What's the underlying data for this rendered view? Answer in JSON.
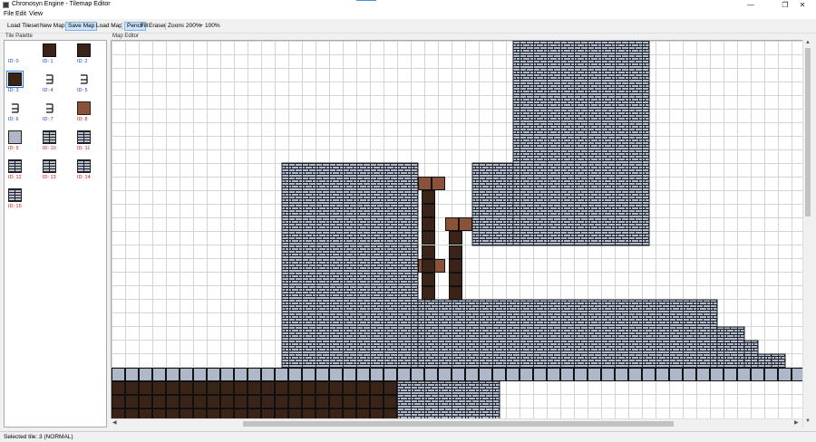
{
  "window": {
    "title": "Chronosyn Engine - Tilemap Editor",
    "controls": {
      "minimize": "—",
      "maximize": "❐",
      "close": "✕"
    }
  },
  "menu": [
    "File",
    "Edit",
    "View"
  ],
  "toolbar": {
    "load_tileset": "Load Tileset",
    "new_map": "New Map",
    "save_map": "Save Map",
    "load_map": "Load Map",
    "pencil": "Pencil",
    "fill": "Fill",
    "eraser": "Eraser",
    "zoom_label": "Zoom:",
    "zoom_out": "-",
    "zoom_value": "200%",
    "zoom_in": "+",
    "zoom_reset": "100%"
  },
  "palette": {
    "title": "Tile Palette",
    "selected_id": 3,
    "tiles": [
      {
        "id": 0,
        "label": "ID: 0",
        "kind": "empty",
        "color_class": "blue"
      },
      {
        "id": 1,
        "label": "ID: 1",
        "kind": "dark",
        "color_class": "blue"
      },
      {
        "id": 2,
        "label": "ID: 2",
        "kind": "dark",
        "color_class": "blue"
      },
      {
        "id": 3,
        "label": "ID: 3",
        "kind": "dark",
        "color_class": "blue"
      },
      {
        "id": 4,
        "label": "ID: 4",
        "kind": "line",
        "color_class": "blue"
      },
      {
        "id": 5,
        "label": "ID: 5",
        "kind": "line",
        "color_class": "blue"
      },
      {
        "id": 6,
        "label": "ID: 6",
        "kind": "line",
        "color_class": "blue"
      },
      {
        "id": 7,
        "label": "ID: 7",
        "kind": "line",
        "color_class": "blue"
      },
      {
        "id": 8,
        "label": "ID: 8",
        "kind": "brown",
        "color_class": "red"
      },
      {
        "id": 9,
        "label": "ID: 9",
        "kind": "stone",
        "color_class": "red"
      },
      {
        "id": 10,
        "label": "ID: 10",
        "kind": "brick",
        "color_class": "red"
      },
      {
        "id": 11,
        "label": "ID: 11",
        "kind": "brick",
        "color_class": "red"
      },
      {
        "id": 12,
        "label": "ID: 12",
        "kind": "brick",
        "color_class": "red"
      },
      {
        "id": 13,
        "label": "ID: 13",
        "kind": "brick",
        "color_class": "red"
      },
      {
        "id": 14,
        "label": "ID: 14",
        "kind": "brick",
        "color_class": "red"
      },
      {
        "id": 15,
        "label": "ID: 15",
        "kind": "brick",
        "color_class": "red"
      }
    ]
  },
  "editor": {
    "title": "Map Editor",
    "colors": {
      "grid": "#d4d4d4",
      "brick": "#b3bccc",
      "brick_line": "#1e2028",
      "dark": "#3a2418",
      "brown": "#8a5238",
      "stone": "#aeb8c8"
    }
  },
  "status": {
    "text": "Selected tile: 3 (NORMAL)"
  }
}
